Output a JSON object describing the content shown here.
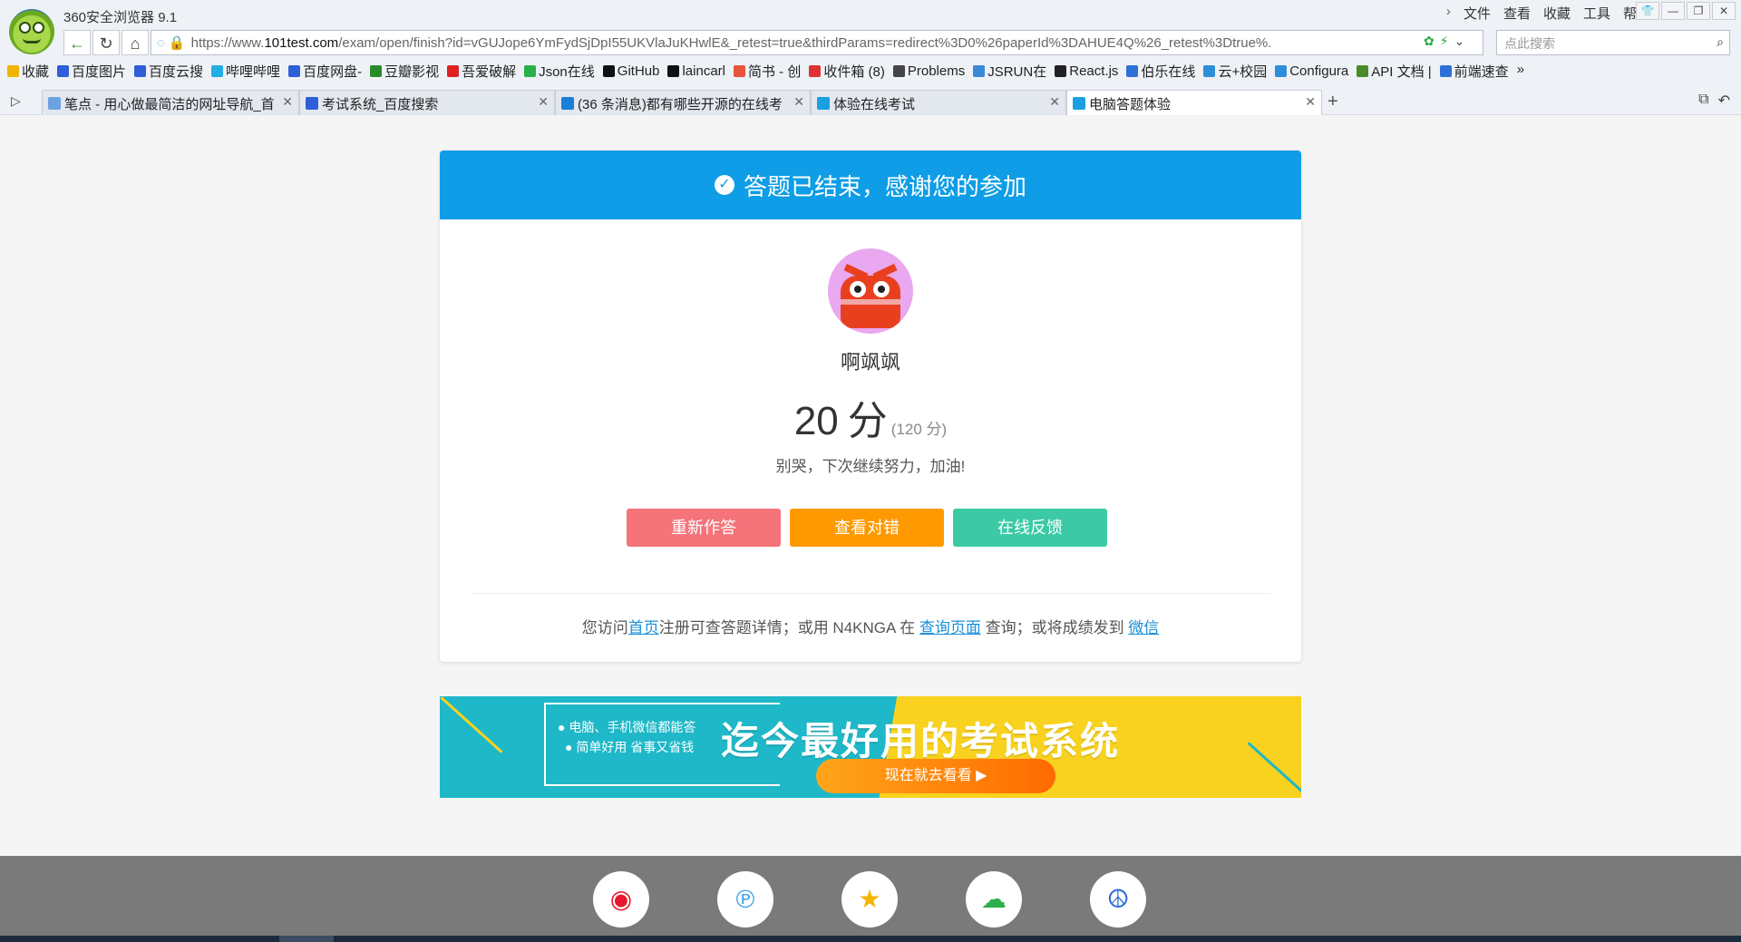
{
  "browser": {
    "title": "360安全浏览器 9.1",
    "menu": [
      "文件",
      "查看",
      "收藏",
      "工具",
      "帮助"
    ],
    "address": {
      "prefix": "https://www.",
      "host": "101test.com",
      "path": "/exam/open/finish?id=vGUJope6YmFydSjDpI55UKVlaJuKHwlE&_retest=true&thirdParams=redirect%3D0%26paperId%3DAHUE4Q%26_retest%3Dtrue%."
    },
    "search_placeholder": "点此搜索",
    "bookmarks": [
      {
        "label": "收藏",
        "icon": "star-icon",
        "color": "#f0b400"
      },
      {
        "label": "百度图片",
        "icon": "baidu-icon",
        "color": "#2e5fd8"
      },
      {
        "label": "百度云搜",
        "icon": "cloud-icon",
        "color": "#2e5fd8"
      },
      {
        "label": "哔哩哔哩",
        "icon": "bilibili-icon",
        "color": "#23ade5"
      },
      {
        "label": "百度网盘-",
        "icon": "cloud-icon",
        "color": "#2e5fd8"
      },
      {
        "label": "豆瓣影视",
        "icon": "douban-icon",
        "color": "#2a8a2a"
      },
      {
        "label": "吾爱破解",
        "icon": "pojie-icon",
        "color": "#d22"
      },
      {
        "label": "Json在线",
        "icon": "json-icon",
        "color": "#2ab04a"
      },
      {
        "label": "GitHub",
        "icon": "github-icon",
        "color": "#111"
      },
      {
        "label": "laincarl",
        "icon": "github-icon",
        "color": "#111"
      },
      {
        "label": "简书 - 创",
        "icon": "jianshu-icon",
        "color": "#e8543c"
      },
      {
        "label": "收件箱 (8)",
        "icon": "gmail-icon",
        "color": "#d33"
      },
      {
        "label": "Problems",
        "icon": "problems-icon",
        "color": "#444"
      },
      {
        "label": "JSRUN在",
        "icon": "jsrun-icon",
        "color": "#3a8ad8"
      },
      {
        "label": "React.js",
        "icon": "react-icon",
        "color": "#222"
      },
      {
        "label": "伯乐在线",
        "icon": "bole-icon",
        "color": "#2e6fd8"
      },
      {
        "label": "云+校园",
        "icon": "cloud-icon",
        "color": "#2e8fd8"
      },
      {
        "label": "Configura",
        "icon": "config-icon",
        "color": "#2e8fd8"
      },
      {
        "label": "API 文档 |",
        "icon": "node-icon",
        "color": "#4a8a2a"
      },
      {
        "label": "前端速查",
        "icon": "frontend-icon",
        "color": "#2e6fd8"
      }
    ],
    "tabs": [
      {
        "label": "笔点 - 用心做最简洁的网址导航_首",
        "color": "#6aa3e0"
      },
      {
        "label": "考试系统_百度搜索",
        "color": "#2e5fd8"
      },
      {
        "label": "(36 条消息)都有哪些开源的在线考",
        "color": "#1a7fd8"
      },
      {
        "label": "体验在线考试",
        "color": "#1a9fe0"
      },
      {
        "label": "电脑答题体验",
        "color": "#1a9fe0"
      }
    ]
  },
  "result": {
    "header": "答题已结束，感谢您的参加",
    "username": "啊飒飒",
    "score": "20",
    "score_unit": "分",
    "total": "(120 分)",
    "encourage": "别哭，下次继续努力，加油!",
    "buttons": {
      "retry": "重新作答",
      "review": "查看对错",
      "feedback": "在线反馈"
    },
    "footer": {
      "t1": "您访问",
      "home": "首页",
      "t2": "注册可查答题详情；或用 N4KNGA 在 ",
      "query_page": "查询页面",
      "t3": " 查询；或将成绩发到 ",
      "wechat": "微信"
    }
  },
  "banner": {
    "feature1": "电脑、手机微信都能答",
    "feature2": "简单好用 省事又省钱",
    "slogan": "迄今最好用的考试系统",
    "cta": "现在就去看看"
  },
  "share_icons": [
    "weibo-icon",
    "pinterest-icon",
    "star-badge-icon",
    "wechat-icon",
    "tieba-icon"
  ],
  "colors": {
    "accent": "#0e9de6",
    "retry": "#f4747a",
    "review": "#ff9900",
    "feedback": "#3ccaa6"
  }
}
